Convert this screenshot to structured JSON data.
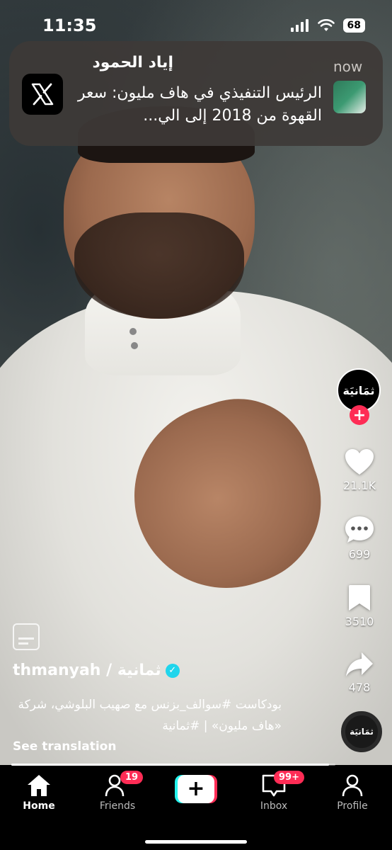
{
  "status_bar": {
    "time": "11:35",
    "battery": "68",
    "icons": [
      "signal-icon",
      "wifi-icon",
      "battery-icon"
    ]
  },
  "notification": {
    "app_icon": "x-logo-icon",
    "sender": "إياد الحمود",
    "time": "now",
    "body": "الرئيس التنفيذي في هاف مليون: سعر القهوة من 2018 إلى الي..."
  },
  "rail": {
    "profile_avatar_text": "ثمَانيَة",
    "likes": "21.1K",
    "comments": "699",
    "saves": "3510",
    "shares": "478",
    "sound_disc_text": "ثمَانيَة"
  },
  "video": {
    "author": "thmanyah / ثمانية",
    "description": "بودكاست #سوالف_بزنس مع صهيب البلوشي، شركة «هاف مليون» | #ثمانية",
    "see_translation": "See translation",
    "progress": 0.98
  },
  "nav": {
    "home": "Home",
    "friends": "Friends",
    "friends_badge": "19",
    "create_label": "+",
    "inbox": "Inbox",
    "inbox_badge": "99+",
    "profile": "Profile"
  },
  "colors": {
    "accent": "#fe2c55",
    "cyan": "#25f4ee",
    "verified": "#20d5ec"
  }
}
